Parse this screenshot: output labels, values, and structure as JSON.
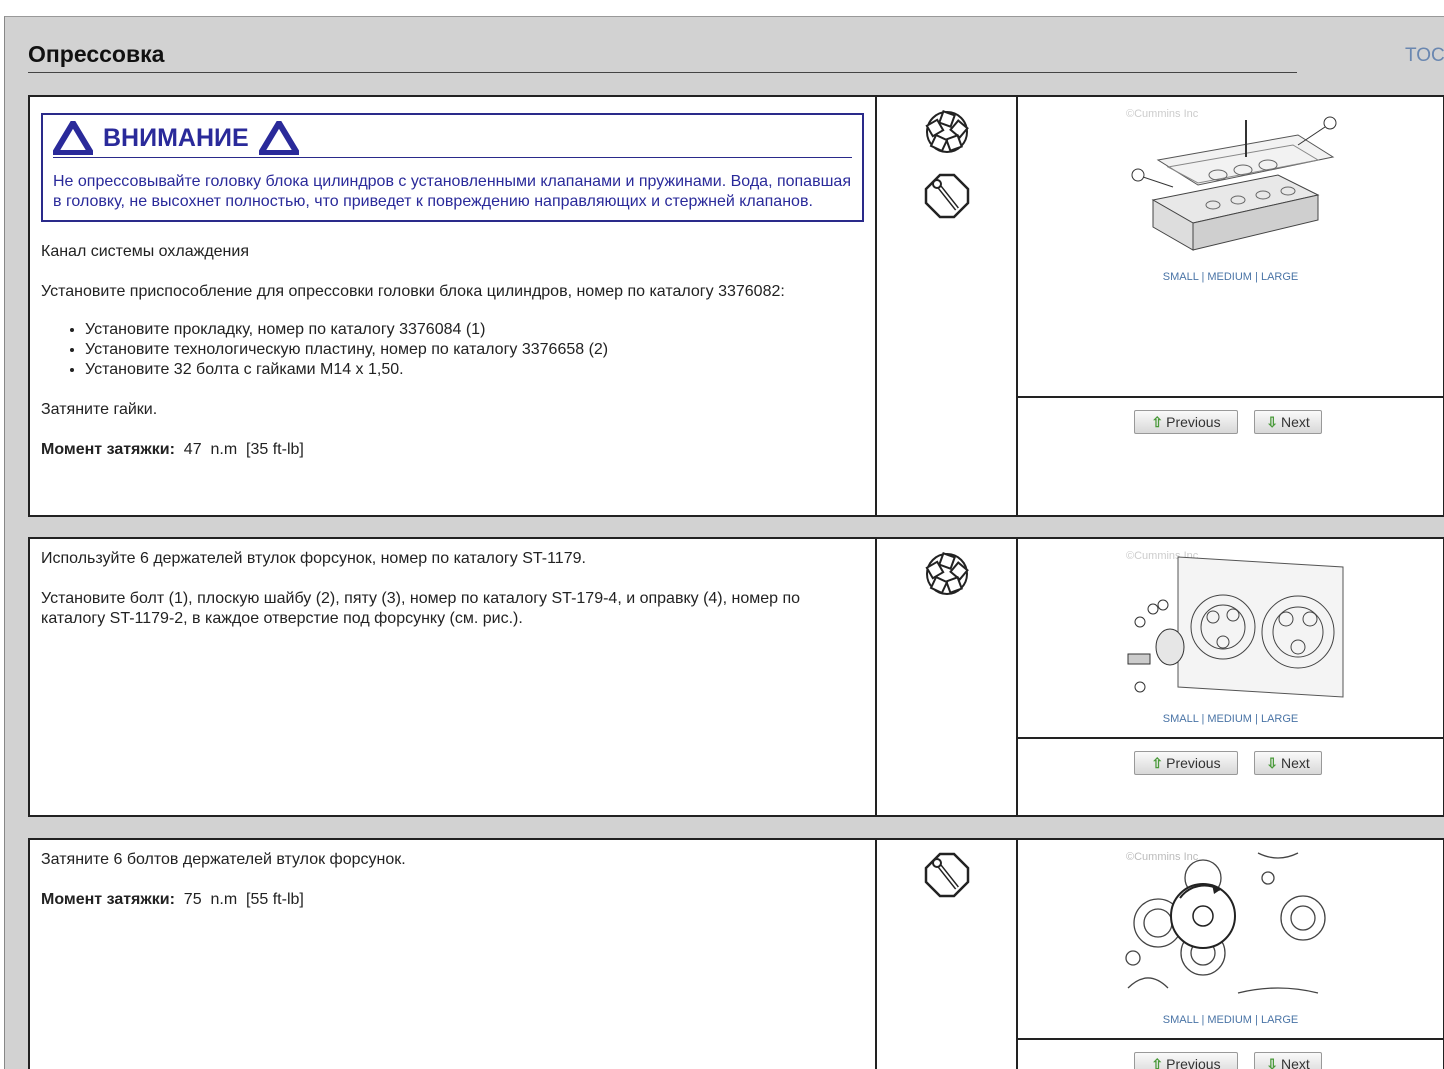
{
  "page": {
    "title": "Опрессовка",
    "toc_link": "TOC"
  },
  "steps": [
    {
      "warning": {
        "title": "ВНИМАНИЕ",
        "text": "Не опрессовывайте головку блока цилиндров с установленными клапанами и пружинами. Вода, попавшая в головку, не высохнет полностью, что приведет к повреждению направляющих и стержней клапанов."
      },
      "paragraphs": [
        "Канал системы охлаждения",
        "Установите приспособление для опрессовки головки блока цилиндров, номер по каталогу 3376082:"
      ],
      "bullets": [
        "Установите прокладку, номер по каталогу 3376084 (1)",
        "Установите технологическую пластину, номер по каталогу 3376658 (2)",
        "Установите 32 болта с гайками М14 x 1,50."
      ],
      "after": "Затяните гайки.",
      "torque": {
        "label": "Момент затяжки:",
        "value": "47",
        "unit": "n.m",
        "imperial": "[35 ft-lb]"
      },
      "icons": [
        "parts-icon",
        "torque-wrench-icon"
      ],
      "image": {
        "watermark": "©Cummins Inc",
        "size_links": "SMALL | MEDIUM | LARGE"
      },
      "nav": {
        "previous": "Previous",
        "next": "Next"
      }
    },
    {
      "paragraphs": [
        "Используйте 6 держателей втулок форсунок, номер по каталогу ST-1179.",
        "Установите болт (1), плоскую шайбу (2), пяту (3), номер по каталогу ST-179-4, и оправку (4), номер по каталогу ST-1179-2, в каждое отверстие под форсунку (см. рис.)."
      ],
      "icons": [
        "parts-icon"
      ],
      "image": {
        "watermark": "©Cummins Inc",
        "size_links": "SMALL | MEDIUM | LARGE"
      },
      "nav": {
        "previous": "Previous",
        "next": "Next"
      }
    },
    {
      "paragraphs": [
        "Затяните 6 болтов держателей втулок форсунок."
      ],
      "torque": {
        "label": "Момент затяжки:",
        "value": "75",
        "unit": "n.m",
        "imperial": "[55 ft-lb]"
      },
      "icons": [
        "torque-wrench-icon"
      ],
      "image": {
        "watermark": "©Cummins Inc",
        "size_links": "SMALL | MEDIUM | LARGE"
      },
      "nav": {
        "previous": "Previous",
        "next": "Next"
      }
    }
  ]
}
